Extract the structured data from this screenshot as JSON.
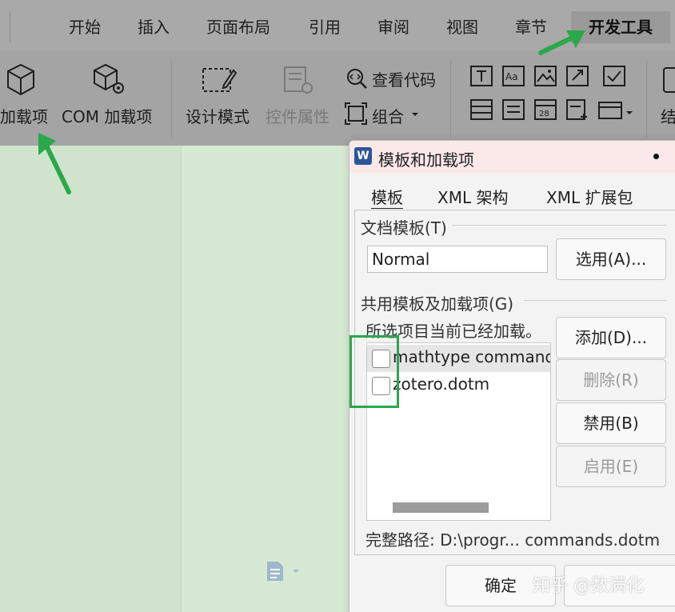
{
  "menu": {
    "tabs": [
      "开始",
      "插入",
      "页面布局",
      "引用",
      "审阅",
      "视图",
      "章节"
    ],
    "active_tab": "开发工具"
  },
  "ribbon": {
    "addins": "加载项",
    "com_addins": "COM 加载项",
    "design_mode": "设计模式",
    "control_props": "控件属性",
    "view_code": "查看代码",
    "group": "组合",
    "cut_label": "结"
  },
  "dialog": {
    "title": "模板和加载项",
    "tabs": [
      "模板",
      "XML 架构",
      "XML 扩展包"
    ],
    "doc_template_label": "文档模板(T)",
    "doc_template_value": "Normal",
    "select_button": "选用(A)...",
    "shared_label": "共用模板及加载项(G)",
    "loaded_note": "所选项目当前已经加载。",
    "items": [
      {
        "name": "mathtype commands.dotm",
        "checked": false
      },
      {
        "name": "zotero.dotm",
        "checked": false
      }
    ],
    "add_button": "添加(D)...",
    "delete_button": "删除(R)",
    "disable_button": "禁用(B)",
    "enable_button": "启用(E)",
    "full_path": "完整路径: D:\\progr... commands.dotm",
    "ok_button": "确定"
  },
  "watermark": "知乎 @数满化",
  "colors": {
    "ribbon_bg": "#a4a4a4",
    "document_bg": "#d0e4cd",
    "dialog_title_bg": "#fbe9ea",
    "annotation_green": "#2aa84a"
  }
}
